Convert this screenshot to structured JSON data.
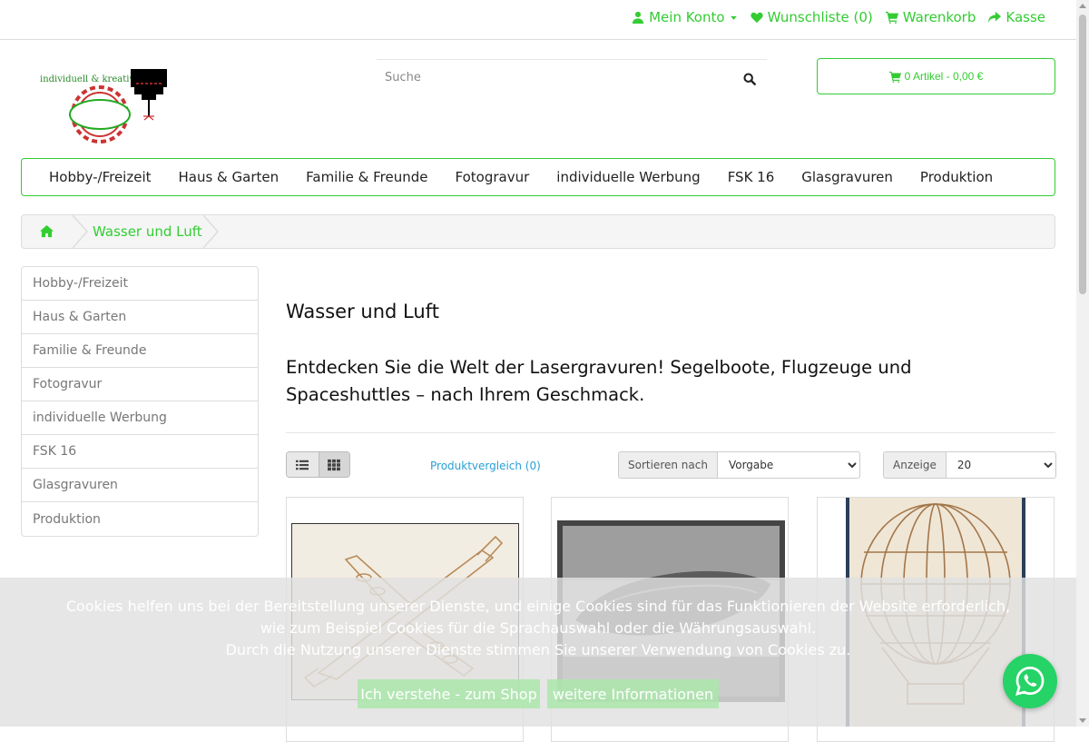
{
  "topbar": {
    "account": "Mein Konto",
    "wishlist": "Wunschliste (0)",
    "cart": "Warenkorb",
    "checkout": "Kasse"
  },
  "logo": {
    "tagline": "individuell & kreativ"
  },
  "search": {
    "placeholder": "Suche"
  },
  "cart_button": {
    "label": "0 Artikel - 0,00 €"
  },
  "menu": [
    "Hobby-/Freizeit",
    "Haus & Garten",
    "Familie & Freunde",
    "Fotogravur",
    "individuelle Werbung",
    "FSK 16",
    "Glasgravuren",
    "Produktion"
  ],
  "breadcrumb": {
    "current": "Wasser und Luft"
  },
  "sidebar": [
    "Hobby-/Freizeit",
    "Haus & Garten",
    "Familie & Freunde",
    "Fotogravur",
    "individuelle Werbung",
    "FSK 16",
    "Glasgravuren",
    "Produktion"
  ],
  "category": {
    "title": "Wasser und Luft",
    "description": "Entdecken Sie die Welt der Lasergravuren! Segelboote, Flugzeuge und Spaceshuttles –  nach Ihrem Geschmack."
  },
  "toolbar": {
    "compare": "Produktvergleich (0)",
    "sort_label": "Sortieren nach",
    "sort_value": "Vorgabe",
    "show_label": "Anzeige",
    "show_value": "20"
  },
  "cookie": {
    "line1": "Cookies helfen uns bei der Bereitstellung unserer Dienste, und einige Cookies sind für das Funktionieren der Website erforderlich,",
    "line2": "wie zum Beispiel Cookies für die Sprachauswahl oder die Währungsauswahl.",
    "line3": "Durch die Nutzung unserer Dienste stimmen Sie unserer Verwendung von Cookies zu.",
    "accept": "Ich verstehe - zum Shop",
    "more": "weitere Informationen"
  },
  "colors": {
    "accent": "#33cc33",
    "link": "#2a9fd6",
    "whatsapp": "#25d366"
  }
}
